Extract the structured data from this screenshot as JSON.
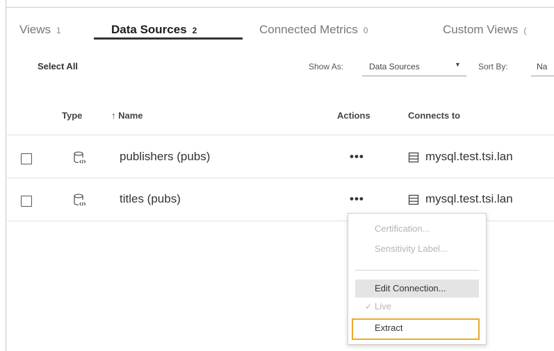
{
  "tabs": [
    {
      "label": "Views",
      "count": "1"
    },
    {
      "label": "Data Sources",
      "count": "2"
    },
    {
      "label": "Connected Metrics",
      "count": "0"
    },
    {
      "label": "Custom Views",
      "count": "("
    }
  ],
  "toolbar": {
    "select_all": "Select All",
    "show_as_label": "Show As:",
    "show_as_value": "Data Sources",
    "sort_by_label": "Sort By:",
    "sort_by_value": "Na"
  },
  "table": {
    "headers": {
      "type": "Type",
      "name_arrow": "↑",
      "name": "Name",
      "actions": "Actions",
      "connects_to": "Connects to"
    },
    "rows": [
      {
        "name": "publishers (pubs)",
        "actions": "•••",
        "connects_to": "mysql.test.tsi.lan"
      },
      {
        "name": "titles (pubs)",
        "actions": "•••",
        "connects_to": "mysql.test.tsi.lan"
      }
    ]
  },
  "menu": {
    "items": [
      {
        "label": "Certification...",
        "state": "disabled"
      },
      {
        "label": "Sensitivity Label...",
        "state": "disabled"
      },
      {
        "label": "Edit Connection...",
        "state": "hover"
      },
      {
        "label": "Live",
        "state": "disabled",
        "checked": true,
        "check_mark": "✓"
      },
      {
        "label": "Extract",
        "state": "enabled",
        "highlighted": true
      }
    ]
  },
  "colors": {
    "highlight": "#f0a72a",
    "active_tab": "#333333",
    "disabled_text": "#b4b4b4"
  }
}
